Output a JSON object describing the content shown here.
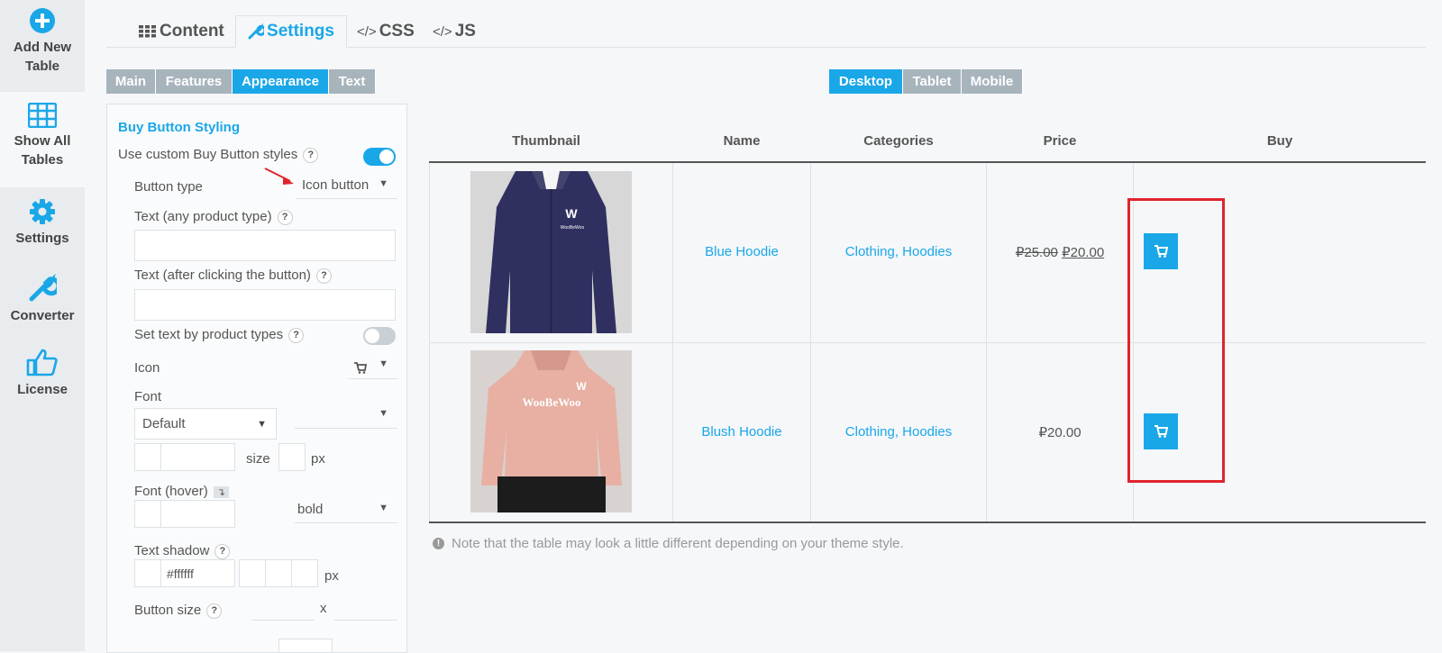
{
  "sidebar": {
    "items": [
      {
        "label": "Add New\nTable",
        "icon": "plus-circle-icon"
      },
      {
        "label": "Show All\nTables",
        "icon": "table-grid-icon"
      },
      {
        "label": "Settings",
        "icon": "gear-icon"
      },
      {
        "label": "Converter",
        "icon": "wrench-icon"
      },
      {
        "label": "License",
        "icon": "thumbs-up-icon"
      }
    ]
  },
  "tabs": {
    "content": "Content",
    "settings": "Settings",
    "css": "CSS",
    "js": "JS",
    "active": "Settings"
  },
  "subtabs": {
    "main": "Main",
    "features": "Features",
    "appearance": "Appearance",
    "text": "Text",
    "active": "Appearance"
  },
  "device_tabs": {
    "desktop": "Desktop",
    "tablet": "Tablet",
    "mobile": "Mobile",
    "active": "Desktop"
  },
  "panel": {
    "section_title": "Buy Button Styling",
    "use_custom_label": "Use custom Buy Button styles",
    "use_custom_on": true,
    "button_type_label": "Button type",
    "button_type_value": "Icon button",
    "text_any_label": "Text (any product type)",
    "text_any_value": "",
    "text_after_label": "Text (after clicking the button)",
    "text_after_value": "",
    "set_text_label": "Set text by product types",
    "set_text_on": false,
    "icon_label": "Icon",
    "font_label": "Font",
    "font_value": "Default",
    "size_label": "size",
    "px": "px",
    "font_hover_label": "Font (hover)",
    "font_hover_weight": "bold",
    "text_shadow_label": "Text shadow",
    "text_shadow_color": "#ffffff",
    "button_size_label": "Button size",
    "button_size_x": "x"
  },
  "table": {
    "headers": [
      "Thumbnail",
      "Name",
      "Categories",
      "Price",
      "Buy"
    ],
    "rows": [
      {
        "name": "Blue Hoodie",
        "categories": "Clothing, Hoodies",
        "price_old": "₽25.00",
        "price_new": "₽20.00",
        "image": "blue-hoodie-thumbnail"
      },
      {
        "name": "Blush Hoodie",
        "categories": "Clothing, Hoodies",
        "price_old": "",
        "price_new": "₽20.00",
        "image": "blush-hoodie-thumbnail"
      }
    ],
    "hoodie_logo_text": "WooBeWoo"
  },
  "note": "Note that the table may look a little different depending on your theme style.",
  "colors": {
    "accent": "#1aa7e8",
    "subtab_inactive": "#a8b4bc",
    "annotation_red": "#e0242b"
  }
}
